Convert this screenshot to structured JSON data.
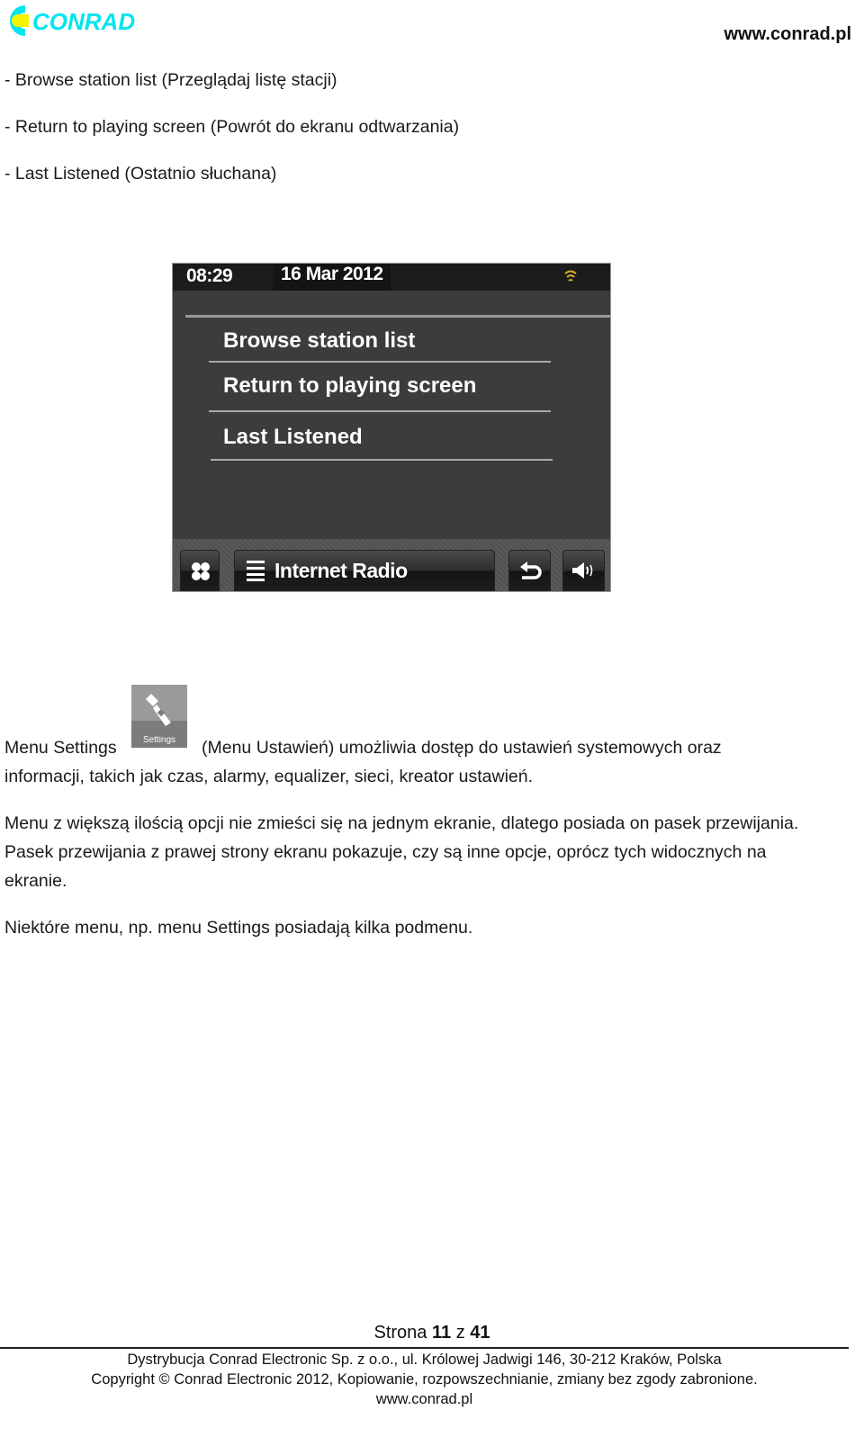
{
  "header": {
    "logo_text": "CONRAD",
    "site_url": "www.conrad.pl",
    "logo_colors": {
      "primary": "#00e5ee",
      "accent": "#f4f400"
    }
  },
  "bullets": [
    "- Browse station list (Przeglądaj listę stacji)",
    "- Return to playing screen (Powrót do ekranu odtwarzania)",
    "- Last Listened (Ostatnio słuchana)"
  ],
  "device_screen": {
    "time": "08:29",
    "date": "16 Mar 2012",
    "status_icon": "wifi-icon",
    "menu_items": [
      "Browse station list",
      "Return to playing screen",
      "Last Listened"
    ],
    "bottom_bar": {
      "home_icon": "grid-icon",
      "source_icon": "list-icon",
      "source_label": "Internet Radio",
      "back_icon": "back-arrow-icon",
      "volume_icon": "speaker-icon"
    }
  },
  "settings_icon_label": "Settings",
  "paragraphs": {
    "settings_line1_before": "Menu Settings",
    "settings_line1_after": "(Menu Ustawień) umożliwia dostęp do ustawień systemowych oraz",
    "settings_line2": "informacji, takich jak czas, alarmy, equalizer, sieci, kreator ustawień.",
    "scroll_line1": "Menu z większą ilością opcji nie zmieści się na jednym ekranie, dlatego posiada on pasek przewijania.",
    "scroll_line2": "Pasek przewijania z prawej strony ekranu pokazuje, czy są inne opcje, oprócz tych widocznych na",
    "scroll_line3": "ekranie.",
    "submenu_line": "Niektóre menu, np. menu Settings posiadają kilka podmenu."
  },
  "footer": {
    "page_prefix": "Strona",
    "page_current": "11",
    "page_sep": "z",
    "page_total": "41",
    "line1": "Dystrybucja Conrad Electronic Sp. z o.o., ul. Królowej Jadwigi 146, 30-212 Kraków, Polska",
    "line2": "Copyright © Conrad Electronic 2012, Kopiowanie, rozpowszechnianie, zmiany bez zgody zabronione.",
    "line3": "www.conrad.pl"
  }
}
